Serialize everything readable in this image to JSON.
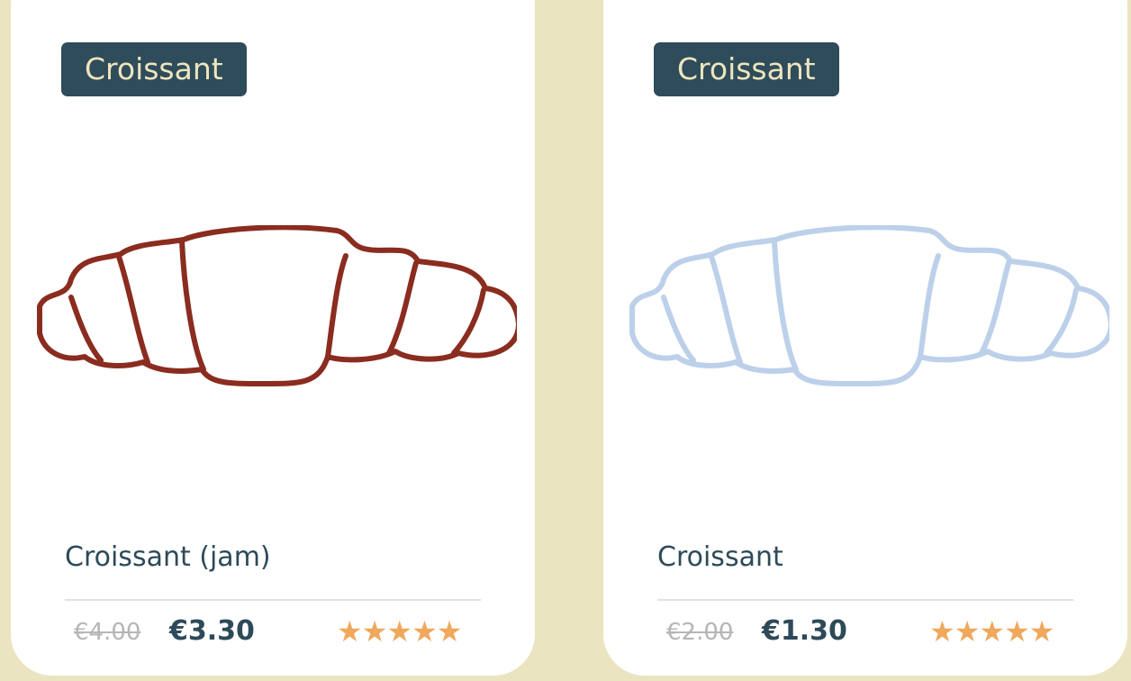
{
  "cards": [
    {
      "badge": "Croissant",
      "title": "Croissant (jam)",
      "old_price": "€4.00",
      "price": "€3.30",
      "stars": "★★★★★",
      "rating": 5,
      "illustration_color": "#8a2c1f"
    },
    {
      "badge": "Croissant",
      "title": "Croissant",
      "old_price": "€2.00",
      "price": "€1.30",
      "stars": "★★★★★",
      "rating": 5,
      "illustration_color": "#bcd0ea"
    }
  ],
  "colors": {
    "background": "#ebe4c1",
    "badge_bg": "#2f4c5a",
    "badge_text": "#ede5bf",
    "star": "#f0a85c",
    "title": "#2d4a58"
  },
  "icons": [
    "croissant-icon",
    "star-icon"
  ]
}
